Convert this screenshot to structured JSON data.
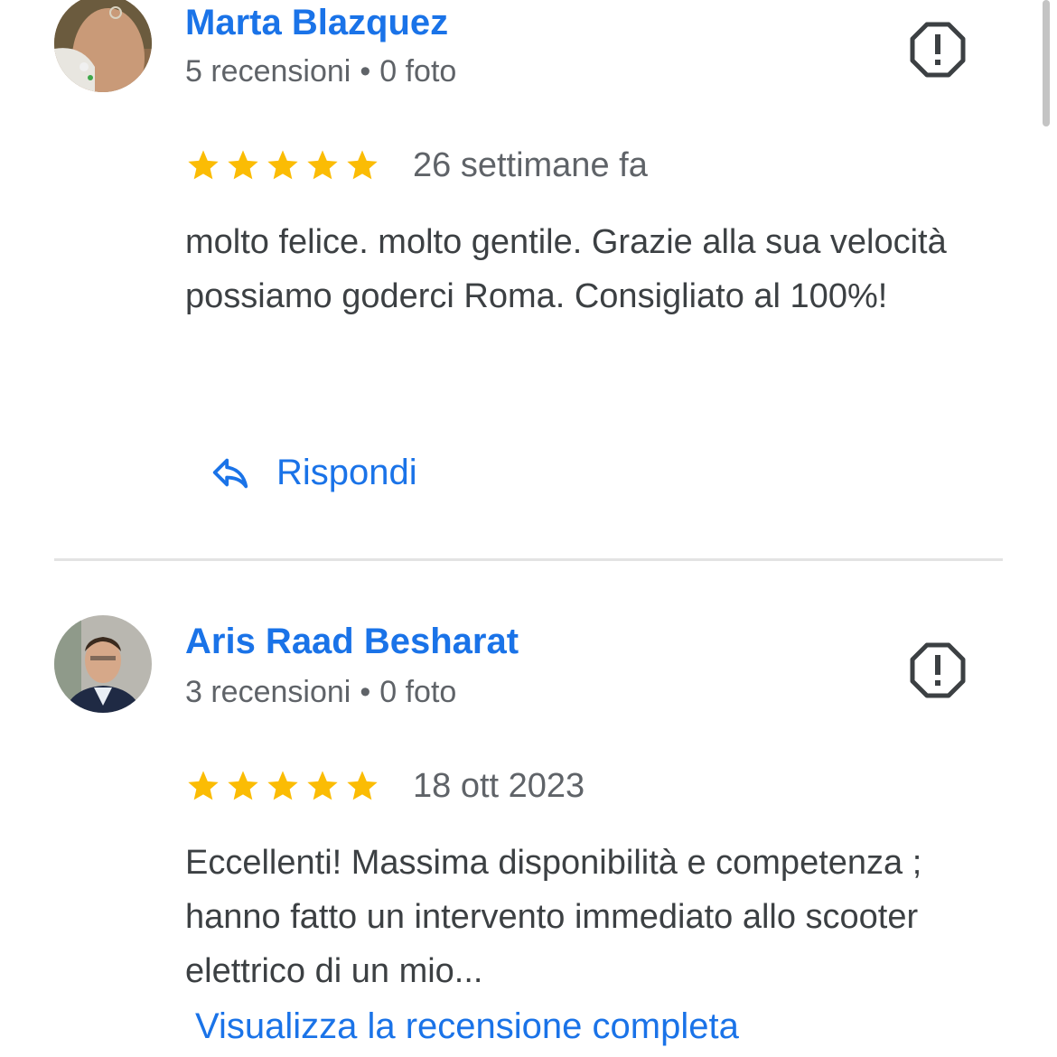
{
  "reviews": [
    {
      "author": "Marta Blazquez",
      "review_count": "5 recensioni",
      "separator": "•",
      "photo_count": "0 foto",
      "rating": 5,
      "date": "26 settimane fa",
      "text": "molto felice. molto gentile. Grazie alla sua velocità possiamo goderci Roma. Consigliato al 100%!",
      "reply_label": "Rispondi"
    },
    {
      "author": "Aris Raad Besharat",
      "review_count": "3 recensioni",
      "separator": "•",
      "photo_count": "0 foto",
      "rating": 5,
      "date": "18 ott 2023",
      "text": "Eccellenti! Massima disponibilità e competenza ; hanno fatto un intervento immediato allo scooter elettrico di un mio...",
      "read_more_label": "Visualizza la recensione completa"
    }
  ],
  "colors": {
    "link": "#1a73e8",
    "star": "#fbbc04",
    "text": "#3c4043",
    "secondary": "#5f6368",
    "divider": "#e3e3e3"
  },
  "icons": {
    "report": "report-icon",
    "star": "star-icon",
    "reply": "reply-arrow-icon"
  }
}
